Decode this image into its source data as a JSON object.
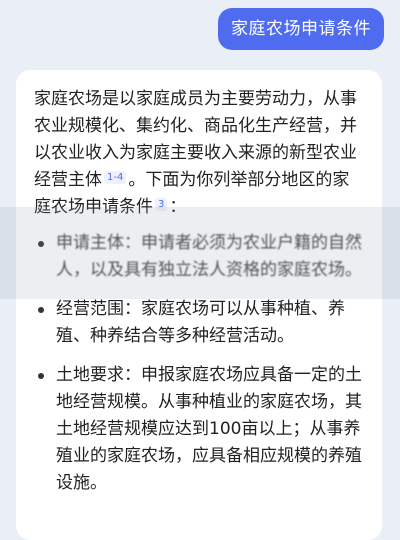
{
  "user_message": {
    "text": "家庭农场申请条件"
  },
  "answer": {
    "intro_part1": "家庭农场是以家庭成员为主要劳动力，从事农业规模化、集约化、商品化生产经营，并以农业收入为家庭主要收入来源的新型农业经营主体",
    "cite1": "1-4",
    "intro_part2": "。下面为你列举部分地区的家庭农场申请条件",
    "cite2": "3",
    "intro_part3": "：",
    "items": [
      {
        "text": "申请主体：申请者必须为农业户籍的自然人，以及具有独立法人资格的家庭农场。"
      },
      {
        "text": "经营范围：家庭农场可以从事种植、养殖、种养结合等多种经营活动。"
      },
      {
        "text": "土地要求：申报家庭农场应具备一定的土地经营规模。从事种植业的家庭农场，其土地经营规模应达到100亩以上；从事养殖业的家庭农场，应具备相应规模的养殖设施。"
      }
    ]
  },
  "colors": {
    "accent": "#4f6bf0",
    "background": "#eaeef6",
    "card": "#ffffff"
  }
}
